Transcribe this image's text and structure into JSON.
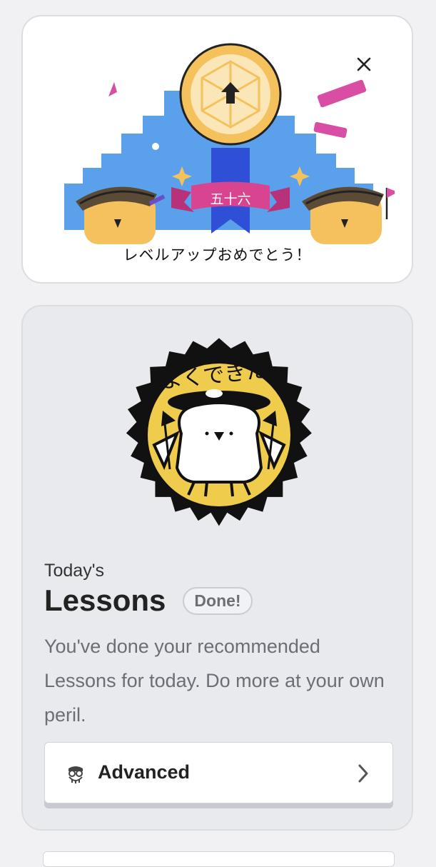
{
  "level_up": {
    "level_number": "五十六",
    "message": "レベルアップおめでとう！",
    "close_icon": "close-icon"
  },
  "lessons_card": {
    "badge_text": "よくできた!",
    "eyebrow": "Today's",
    "title": "Lessons",
    "status_badge": "Done!",
    "description": "You've done your recommended Lessons for today. Do more at your own peril.",
    "advanced_button": {
      "label": "Advanced",
      "icon": "crabigator-icon",
      "chevron": "chevron-right-icon"
    }
  },
  "colors": {
    "background": "#f1f1f3",
    "levelup_card": "#ffffff",
    "lessons_card": "#e8eaee",
    "stairs_blue": "#5aa0ea",
    "medal_gold": "#f5c15d",
    "ribbon_pink": "#d8448f",
    "ribbon_blue": "#2f4fd6",
    "badge_yellow": "#f0cc4c",
    "accent_pink": "#d84ea5"
  }
}
